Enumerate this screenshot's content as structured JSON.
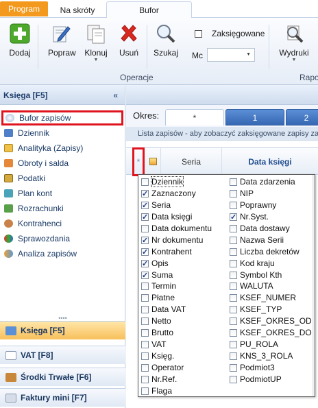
{
  "ribbon_tabs": {
    "program": "Program",
    "shortcuts": "Na skróty",
    "buffer": "Bufor"
  },
  "toolbar": {
    "add": "Dodaj",
    "edit": "Popraw",
    "clone": "Klonuj",
    "delete": "Usuń",
    "search": "Szukaj",
    "posted_label": "Zaksięgowane",
    "month_label": "Mc",
    "month_value": "",
    "prints": "Wydruki",
    "group_operations": "Operacje",
    "group_reports": "Rapo"
  },
  "left_panel": {
    "header": "Księga [F5]",
    "collapse": "«",
    "items": [
      "Bufor zapisów",
      "Dziennik",
      "Analityka (Zapisy)",
      "Obroty i salda",
      "Podatki",
      "Plan kont",
      "Rozrachunki",
      "Kontrahenci",
      "Sprawozdania",
      "Analiza zapisów"
    ],
    "grip": "••••",
    "modules": [
      "Księga [F5]",
      "VAT [F8]",
      "Środki Trwałe [F6]",
      "Faktury mini [F7]"
    ]
  },
  "period": {
    "label": "Okres:",
    "tabs": [
      "*",
      "1",
      "2"
    ]
  },
  "info_text": "Lista zapisów - aby zobaczyć zaksięgowane zapisy zazn",
  "grid_header": {
    "asterisk": "*",
    "col_series": "Seria",
    "col_date": "Data księgi"
  },
  "column_chooser": {
    "left": [
      {
        "label": "Dziennik",
        "checked": false
      },
      {
        "label": "Zaznaczony",
        "checked": true
      },
      {
        "label": "Seria",
        "checked": true
      },
      {
        "label": "Data księgi",
        "checked": true
      },
      {
        "label": "Data dokumentu",
        "checked": false
      },
      {
        "label": "Nr dokumentu",
        "checked": true
      },
      {
        "label": "Kontrahent",
        "checked": true
      },
      {
        "label": "Opis",
        "checked": true
      },
      {
        "label": "Suma",
        "checked": true
      },
      {
        "label": "Termin",
        "checked": false
      },
      {
        "label": "Płatne",
        "checked": false
      },
      {
        "label": "Data VAT",
        "checked": false
      },
      {
        "label": "Netto",
        "checked": false
      },
      {
        "label": "Brutto",
        "checked": false
      },
      {
        "label": "VAT",
        "checked": false
      },
      {
        "label": "Księg.",
        "checked": false
      },
      {
        "label": "Operator",
        "checked": false
      },
      {
        "label": "Nr.Ref.",
        "checked": false
      },
      {
        "label": "Flaga",
        "checked": false
      }
    ],
    "right": [
      {
        "label": "Data zdarzenia",
        "checked": false
      },
      {
        "label": "NIP",
        "checked": false
      },
      {
        "label": "Poprawny",
        "checked": false
      },
      {
        "label": "Nr.Syst.",
        "checked": true
      },
      {
        "label": "Data dostawy",
        "checked": false
      },
      {
        "label": "Nazwa Serii",
        "checked": false
      },
      {
        "label": "Liczba dekretów",
        "checked": false
      },
      {
        "label": "Kod kraju",
        "checked": false
      },
      {
        "label": "Symbol Kth",
        "checked": false
      },
      {
        "label": "WALUTA",
        "checked": false
      },
      {
        "label": "KSEF_NUMER",
        "checked": false
      },
      {
        "label": "KSEF_TYP",
        "checked": false
      },
      {
        "label": "KSEF_OKRES_OD",
        "checked": false
      },
      {
        "label": "KSEF_OKRES_DO",
        "checked": false
      },
      {
        "label": "PU_ROLA",
        "checked": false
      },
      {
        "label": "KNS_3_ROLA",
        "checked": false
      },
      {
        "label": "Podmiot3",
        "checked": false
      },
      {
        "label": "PodmiotUP",
        "checked": false
      }
    ]
  },
  "colors": {
    "accent_orange": "#f39a1e",
    "highlight_red": "#e0141e",
    "nav_blue": "#1a3a66",
    "period_tab_blue": "#3668b3"
  }
}
